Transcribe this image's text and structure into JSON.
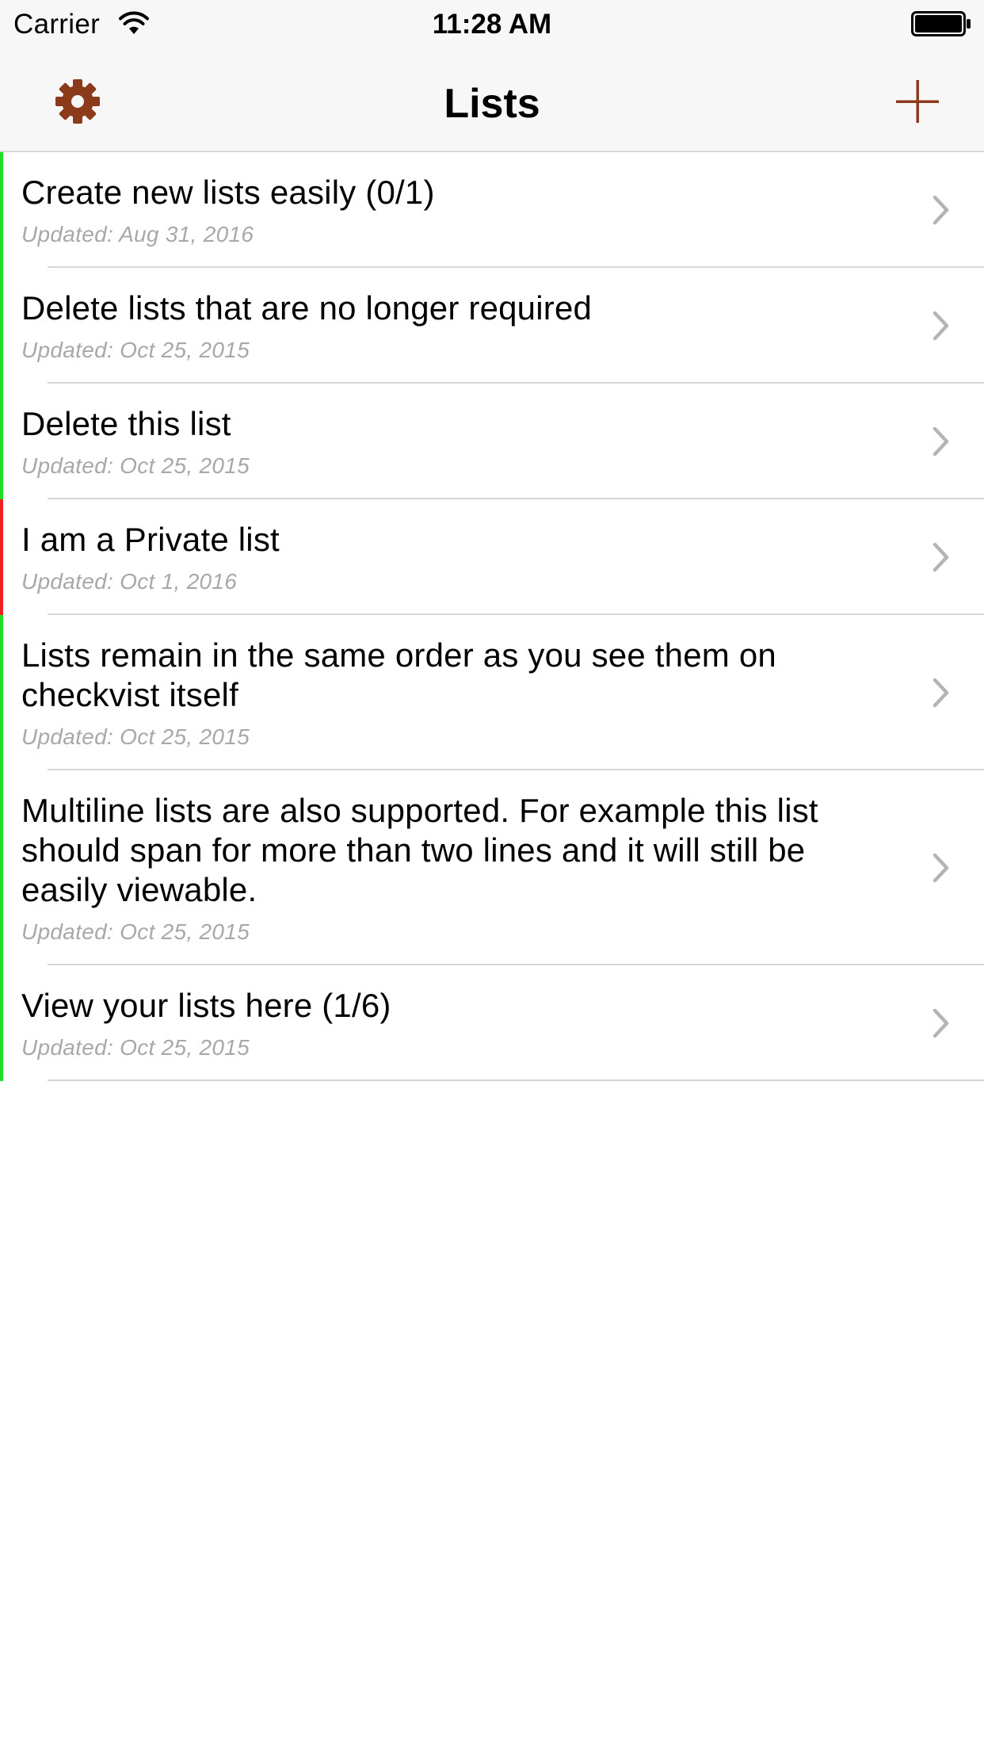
{
  "status_bar": {
    "carrier": "Carrier",
    "time": "11:28 AM",
    "wifi_icon": "wifi-icon",
    "battery_icon": "battery-full-icon"
  },
  "nav_bar": {
    "title": "Lists",
    "left_icon": "gear-icon",
    "right_icon": "plus-icon",
    "accent_color": "#8b3a1a"
  },
  "lists": [
    {
      "title": "Create new lists easily (0/1)",
      "updated": "Updated: Aug 31, 2016",
      "status_color": "#22dd22"
    },
    {
      "title": "Delete lists that are no longer required",
      "updated": "Updated: Oct 25, 2015",
      "status_color": "#22dd22"
    },
    {
      "title": "Delete this list",
      "updated": "Updated: Oct 25, 2015",
      "status_color": "#22dd22"
    },
    {
      "title": "I am a Private list",
      "updated": "Updated: Oct 1, 2016",
      "status_color": "#ee2222"
    },
    {
      "title": "Lists remain in the same order as you see them on checkvist itself",
      "updated": "Updated: Oct 25, 2015",
      "status_color": "#22dd22"
    },
    {
      "title": "Multiline lists are also supported. For example this list should span for more than two lines and it will still be easily viewable.",
      "updated": "Updated: Oct 25, 2015",
      "status_color": "#22dd22"
    },
    {
      "title": "View your lists here (1/6)",
      "updated": "Updated: Oct 25, 2015",
      "status_color": "#22dd22"
    }
  ],
  "row_chevron_icon": "chevron-right-icon",
  "chevron_color": "#b4b4b4"
}
